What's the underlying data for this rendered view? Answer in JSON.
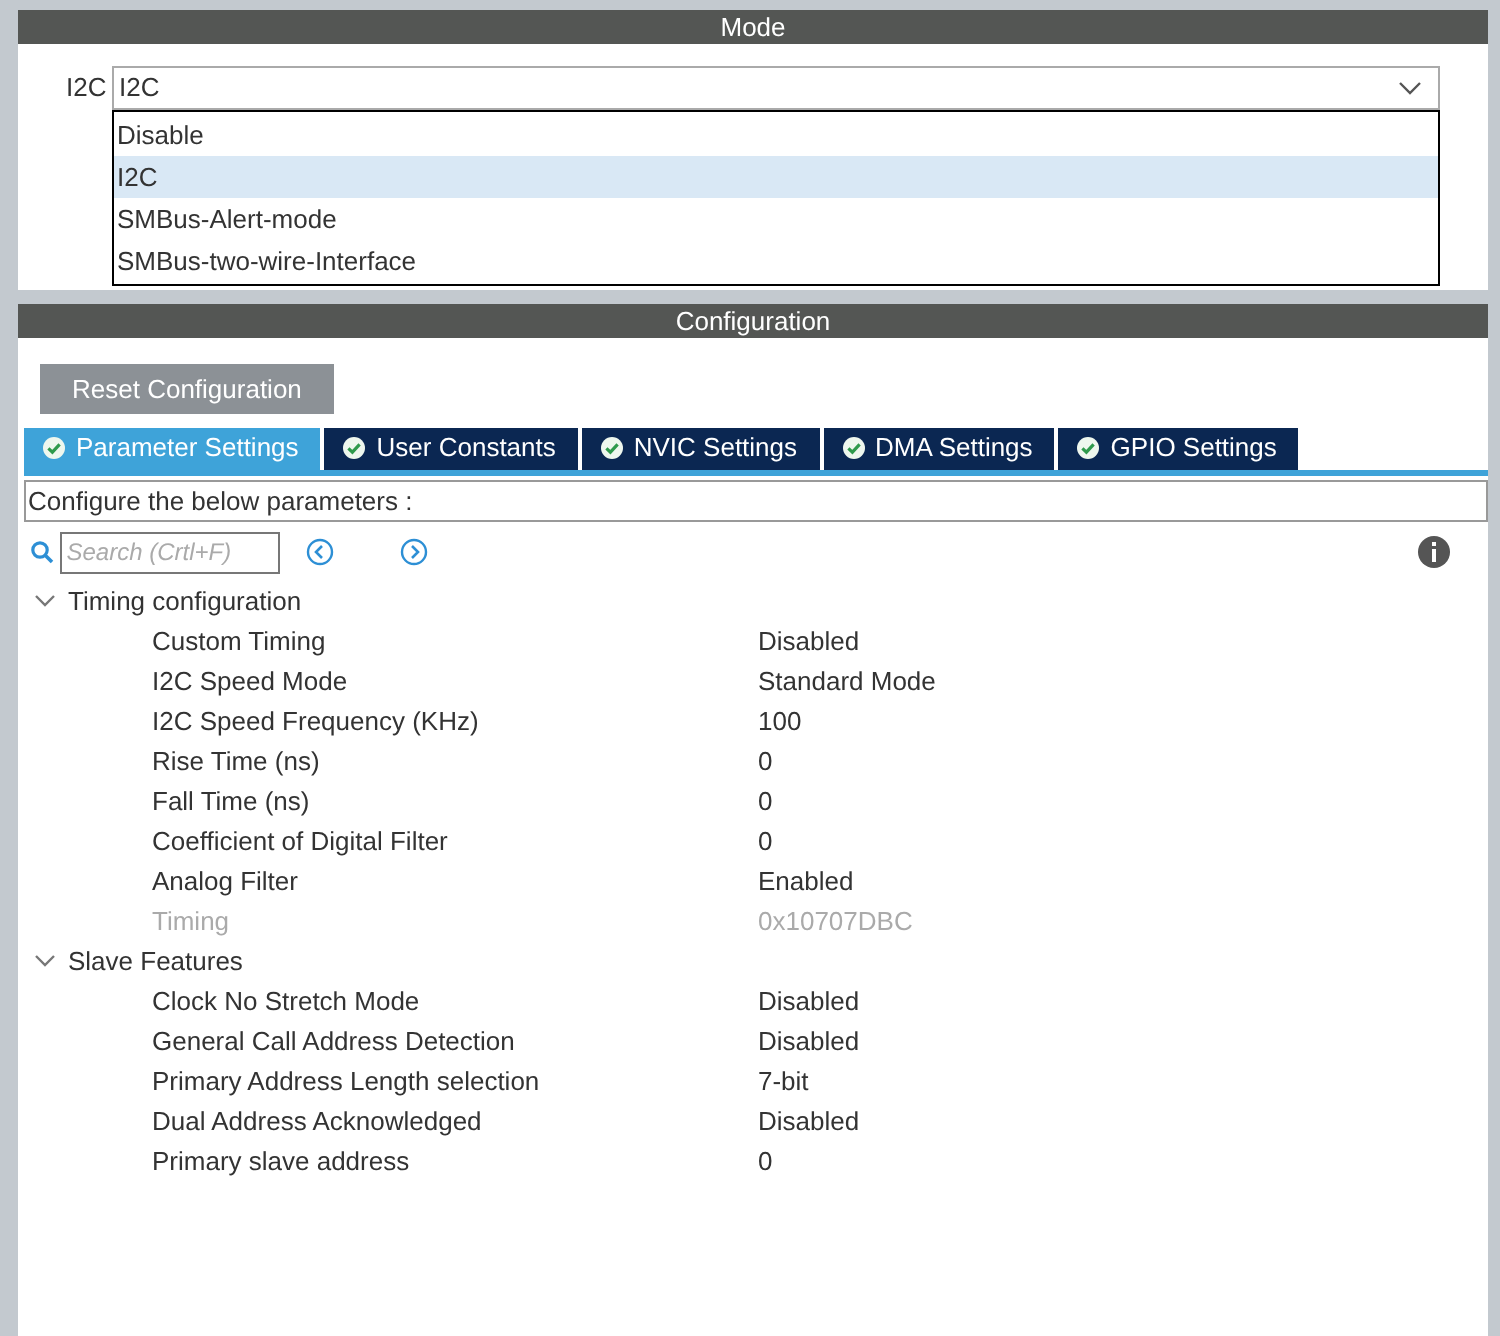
{
  "mode_panel": {
    "title": "Mode",
    "field_label": "I2C",
    "select": {
      "value": "I2C",
      "expanded": true
    },
    "options": [
      {
        "label": "Disable",
        "selected": false
      },
      {
        "label": "I2C",
        "selected": true
      },
      {
        "label": "SMBus-Alert-mode",
        "selected": false
      },
      {
        "label": "SMBus-two-wire-Interface",
        "selected": false
      }
    ]
  },
  "configuration_panel": {
    "title": "Configuration",
    "reset_button": "Reset Configuration",
    "tabs": [
      {
        "label": "Parameter Settings",
        "selected": true
      },
      {
        "label": "User Constants",
        "selected": false
      },
      {
        "label": "NVIC Settings",
        "selected": false
      },
      {
        "label": "DMA Settings",
        "selected": false
      },
      {
        "label": "GPIO Settings",
        "selected": false
      }
    ],
    "description": "Configure the below parameters :",
    "search": {
      "placeholder": "Search (Crtl+F)"
    },
    "tree": [
      {
        "label": "Timing configuration",
        "expanded": true,
        "children": [
          {
            "label": "Custom Timing",
            "value": "Disabled",
            "disabled": false
          },
          {
            "label": "I2C Speed Mode",
            "value": "Standard Mode",
            "disabled": false
          },
          {
            "label": "I2C Speed Frequency (KHz)",
            "value": "100",
            "disabled": false
          },
          {
            "label": "Rise Time (ns)",
            "value": "0",
            "disabled": false
          },
          {
            "label": "Fall Time (ns)",
            "value": "0",
            "disabled": false
          },
          {
            "label": "Coefficient of Digital Filter",
            "value": "0",
            "disabled": false
          },
          {
            "label": "Analog Filter",
            "value": "Enabled",
            "disabled": false
          },
          {
            "label": "Timing",
            "value": "0x10707DBC",
            "disabled": true
          }
        ]
      },
      {
        "label": "Slave Features",
        "expanded": true,
        "children": [
          {
            "label": "Clock No Stretch Mode",
            "value": "Disabled",
            "disabled": false
          },
          {
            "label": "General Call Address Detection",
            "value": "Disabled",
            "disabled": false
          },
          {
            "label": "Primary Address Length selection",
            "value": "7-bit",
            "disabled": false
          },
          {
            "label": "Dual Address Acknowledged",
            "value": "Disabled",
            "disabled": false
          },
          {
            "label": "Primary slave address",
            "value": "0",
            "disabled": false
          }
        ]
      }
    ]
  }
}
